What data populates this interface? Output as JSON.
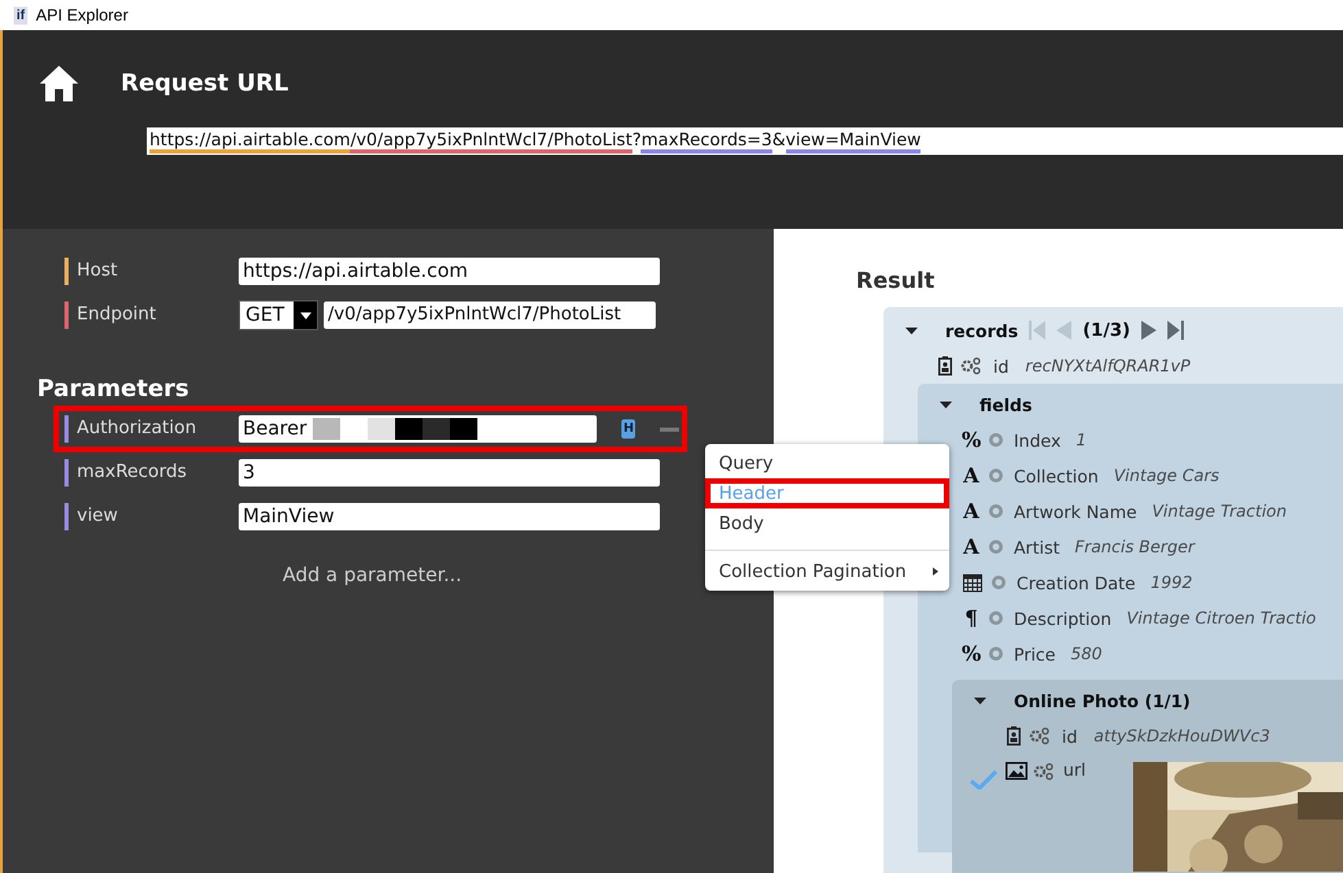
{
  "window": {
    "title": "API Explorer",
    "app_icon": "if"
  },
  "header": {
    "title": "Request URL",
    "url_segments": [
      {
        "text": "https://api.airtable.com",
        "color": "#e8a33c"
      },
      {
        "text": "/v0/app7y5ixPnlntWcl7/PhotoList",
        "color": "#d9676c"
      },
      {
        "text": "?"
      },
      {
        "text": "maxRecords=3",
        "color": "#8a86e8"
      },
      {
        "text": "&"
      },
      {
        "text": "view=MainView",
        "color": "#8a86e8"
      }
    ]
  },
  "settings": [
    {
      "label": "Host",
      "color": "#e8b060",
      "value": "https://api.airtable.com"
    },
    {
      "label": "Endpoint",
      "color": "#d9676c",
      "method": "GET",
      "value": "/v0/app7y5ixPnlntWcl7/PhotoList"
    }
  ],
  "parameters": {
    "title": "Parameters",
    "add_label": "Add a parameter...",
    "items": [
      {
        "label": "Authorization",
        "color": "#9a8ae0",
        "value": "Bearer",
        "redacted": true,
        "highlighted": true,
        "badge": "H"
      },
      {
        "label": "maxRecords",
        "color": "#9a8ae0",
        "value": "3",
        "redacted": false,
        "highlighted": false
      },
      {
        "label": "view",
        "color": "#9a8ae0",
        "value": "MainView",
        "redacted": false,
        "highlighted": false
      }
    ]
  },
  "location_menu": {
    "items": [
      {
        "label": "Query",
        "selected": false,
        "highlighted": false,
        "submenu": false
      },
      {
        "label": "Header",
        "selected": true,
        "highlighted": true,
        "submenu": false
      },
      {
        "label": "Body",
        "selected": false,
        "highlighted": false,
        "submenu": false
      },
      {
        "label": "Collection Pagination",
        "selected": false,
        "highlighted": false,
        "submenu": true,
        "separator_before": true
      }
    ]
  },
  "result": {
    "title": "Result",
    "records": {
      "label": "records",
      "page": "(1/3)",
      "id_label": "id",
      "id_value": "recNYXtAlfQRAR1vP",
      "fields": {
        "label": "fields",
        "items": [
          {
            "kind": "glyph",
            "glyph": "%",
            "name": "Index",
            "value": "1"
          },
          {
            "kind": "glyph",
            "glyph": "A",
            "name": "Collection",
            "value": "Vintage Cars"
          },
          {
            "kind": "glyph",
            "glyph": "A",
            "name": "Artwork Name",
            "value": "Vintage Traction"
          },
          {
            "kind": "glyph",
            "glyph": "A",
            "name": "Artist",
            "value": "Francis Berger"
          },
          {
            "kind": "date",
            "name": "Creation Date",
            "value": "1992"
          },
          {
            "kind": "glyph",
            "glyph": "¶",
            "name": "Description",
            "value": "Vintage Citroen Tractio"
          },
          {
            "kind": "glyph",
            "glyph": "%",
            "name": "Price",
            "value": "580"
          }
        ]
      },
      "photo": {
        "label": "Online Photo (1/1)",
        "id_label": "id",
        "id_value": "attySkDzkHouDWVc3",
        "url_label": "url",
        "checked": true
      }
    }
  }
}
